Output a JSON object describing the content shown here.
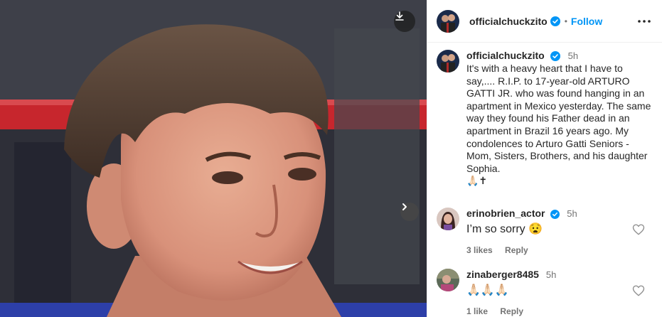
{
  "post": {
    "author": "officialchuckzito",
    "follow_label": "Follow",
    "separator": "•"
  },
  "caption": {
    "username": "officialchuckzito",
    "time": "5h",
    "text": "It's with a heavy heart that I have to say,.... R.I.P.  to 17-year-old ARTURO GATTI  JR. who was found hanging in an apartment in Mexico yesterday. The same way they found his Father dead in an apartment in Brazil 16 years ago. My condolences to Arturo Gatti Seniors - Mom, Sisters, Brothers, and his daughter Sophia.",
    "emoji": "🙏🏻✝"
  },
  "comments": [
    {
      "username": "erinobrien_actor",
      "time": "5h",
      "text": "I’m so sorry 😧",
      "likes": "3 likes",
      "reply": "Reply",
      "verified": true
    },
    {
      "username": "zinaberger8485",
      "time": "5h",
      "text": "🙏🏻🙏🏻🙏🏻",
      "likes": "1 like",
      "reply": "Reply",
      "verified": false
    }
  ],
  "icons": {
    "download": "download-icon",
    "next": "chevron-right-icon",
    "more": "more-horizontal-icon",
    "verified": "verified-badge-icon",
    "heart": "heart-outline-icon"
  },
  "colors": {
    "accent": "#0095f6",
    "text": "#262626",
    "muted": "#737373"
  }
}
